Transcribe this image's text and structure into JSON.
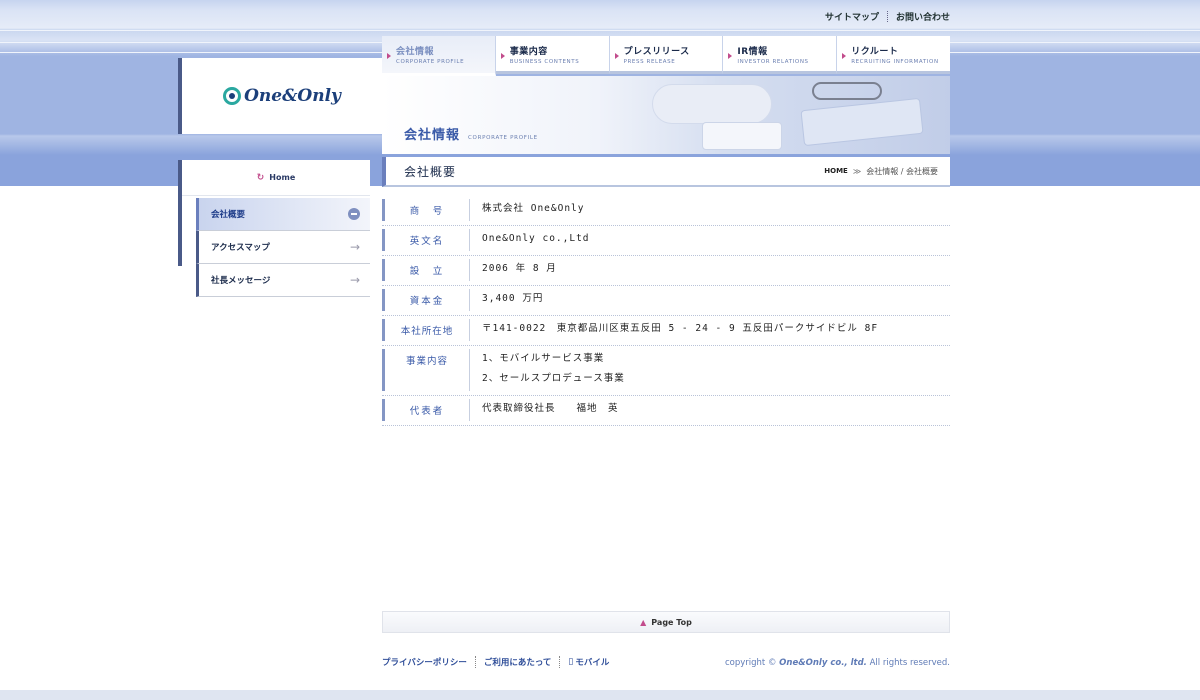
{
  "header": {
    "util_links": [
      "サイトマップ",
      "お問い合わせ"
    ],
    "logo_text": "One&Only"
  },
  "nav": {
    "tabs": [
      {
        "jp": "会社情報",
        "en": "CORPORATE PROFILE",
        "active": true
      },
      {
        "jp": "事業内容",
        "en": "BUSINESS CONTENTS",
        "active": false
      },
      {
        "jp": "プレスリリース",
        "en": "PRESS RELEASE",
        "active": false
      },
      {
        "jp": "IR情報",
        "en": "INVESTOR RELATIONS",
        "active": false
      },
      {
        "jp": "リクルート",
        "en": "RECRUITING INFORMATION",
        "active": false
      }
    ]
  },
  "hero": {
    "title_jp": "会社情報",
    "title_en": "CORPORATE PROFILE"
  },
  "sidebar": {
    "home": "Home",
    "items": [
      {
        "label": "会社概要",
        "active": true
      },
      {
        "label": "アクセスマップ",
        "active": false
      },
      {
        "label": "社長メッセージ",
        "active": false
      }
    ]
  },
  "content": {
    "title": "会社概要",
    "breadcrumb": {
      "home": "HOME",
      "sep": "≫",
      "path": "会社情報 / 会社概要"
    },
    "rows": [
      {
        "label": "商　号",
        "value": [
          "株式会社 One&Only"
        ]
      },
      {
        "label": "英文名",
        "value": [
          "One&Only co.,Ltd"
        ]
      },
      {
        "label": "設　立",
        "value": [
          "2006 年 8 月"
        ]
      },
      {
        "label": "資本金",
        "value": [
          "3,400 万円"
        ]
      },
      {
        "label": "本社所在地",
        "value": [
          "〒141-0022　東京都品川区東五反田 5 - 24 - 9 五反田パークサイドビル 8F"
        ]
      },
      {
        "label": "事業内容",
        "value": [
          "1、モバイルサービス事業",
          "2、セールスプロデュース事業"
        ]
      },
      {
        "label": "代表者",
        "value": [
          "代表取締役社長　　福地　英"
        ]
      }
    ]
  },
  "page_top": "Page Top",
  "footer": {
    "links": [
      "プライバシーポリシー",
      "ご利用にあたって",
      "モバイル"
    ],
    "copyright_prefix": "copyright © ",
    "copyright_brand": "One&Only co., ltd.",
    "copyright_suffix": " All rights reserved."
  },
  "colors": {
    "accent": "#3a5aa8",
    "band": "#9fb4e2",
    "marker": "#c24c8c"
  }
}
